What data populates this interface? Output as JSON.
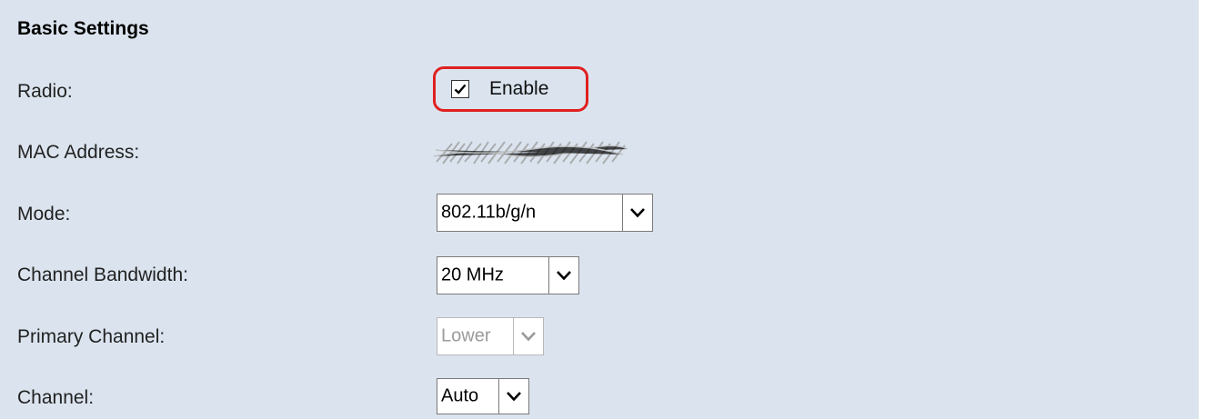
{
  "section": {
    "title": "Basic Settings"
  },
  "radio": {
    "label": "Radio:",
    "checkbox_checked": true,
    "option_label": "Enable"
  },
  "mac_address": {
    "label": "MAC Address:"
  },
  "mode": {
    "label": "Mode:",
    "selected": "802.11b/g/n"
  },
  "channel_bandwidth": {
    "label": "Channel Bandwidth:",
    "selected": "20 MHz"
  },
  "primary_channel": {
    "label": "Primary Channel:",
    "selected": "Lower",
    "disabled": true
  },
  "channel": {
    "label": "Channel:",
    "selected": "Auto"
  },
  "colors": {
    "panel_bg": "#dbe4ee",
    "highlight": "#e02020"
  },
  "icons": {
    "checkbox": "check-icon",
    "dropdown": "chevron-down-icon"
  }
}
